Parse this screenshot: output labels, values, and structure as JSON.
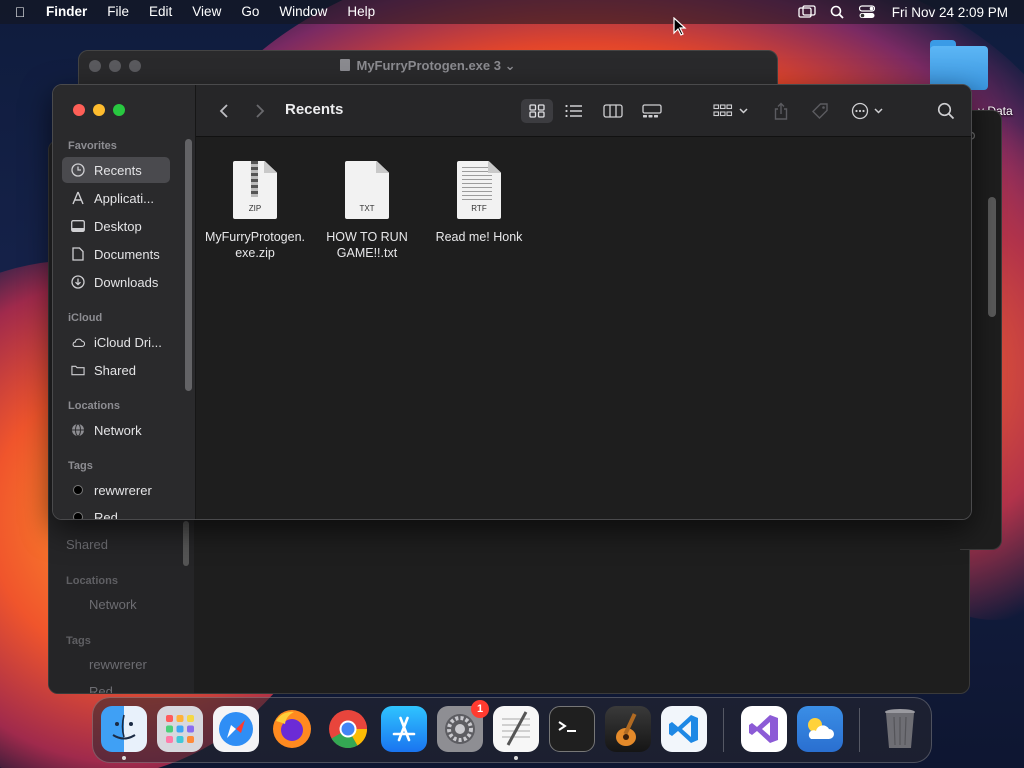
{
  "menubar": {
    "app_name": "Finder",
    "items": [
      "File",
      "Edit",
      "View",
      "Go",
      "Window",
      "Help"
    ],
    "clock": "Fri Nov 24  2:09 PM"
  },
  "desktop": {
    "folder_label_partial": "y Data"
  },
  "back_window": {
    "title": "MyFurryProtogen.exe 3"
  },
  "back_finder": {
    "sidebar": {
      "shared": "Shared",
      "locations": "Locations",
      "network": "Network",
      "tags": "Tags",
      "tag1": "rewwrerer",
      "tag2": "Red"
    }
  },
  "finder": {
    "title": "Recents",
    "sidebar": {
      "favorites_header": "Favorites",
      "favorites": [
        {
          "label": "Recents",
          "icon": "clock-icon"
        },
        {
          "label": "Applicati...",
          "icon": "applications-icon"
        },
        {
          "label": "Desktop",
          "icon": "desktop-icon"
        },
        {
          "label": "Documents",
          "icon": "document-icon"
        },
        {
          "label": "Downloads",
          "icon": "download-icon"
        }
      ],
      "icloud_header": "iCloud",
      "icloud": [
        {
          "label": "iCloud Dri...",
          "icon": "cloud-icon"
        },
        {
          "label": "Shared",
          "icon": "shared-folder-icon"
        }
      ],
      "locations_header": "Locations",
      "locations": [
        {
          "label": "Network",
          "icon": "globe-icon"
        }
      ],
      "tags_header": "Tags",
      "tags": [
        {
          "label": "rewwrerer",
          "color": "#000000"
        },
        {
          "label": "Red",
          "color": "#000000"
        }
      ]
    },
    "files": [
      {
        "name_line1": "MyFurryProtogen.",
        "name_line2": "exe.zip",
        "ext": "ZIP"
      },
      {
        "name_line1": "HOW TO RUN",
        "name_line2": "GAME!!.txt",
        "ext": "TXT"
      },
      {
        "name_line1": "Read me! Honk",
        "name_line2": "",
        "ext": "RTF"
      }
    ]
  },
  "dock": {
    "apps": [
      "Finder",
      "Launchpad",
      "Safari",
      "Firefox",
      "Chrome",
      "App Store",
      "System Settings",
      "TextEdit",
      "Terminal",
      "GarageBand",
      "Visual Studio Code",
      "Visual Studio",
      "Weather",
      "Trash"
    ],
    "settings_badge": "1"
  },
  "colors": {
    "close": "#fe5f57",
    "minimize": "#febc2e",
    "maximize": "#28c840",
    "badge": "#ff3b30"
  }
}
